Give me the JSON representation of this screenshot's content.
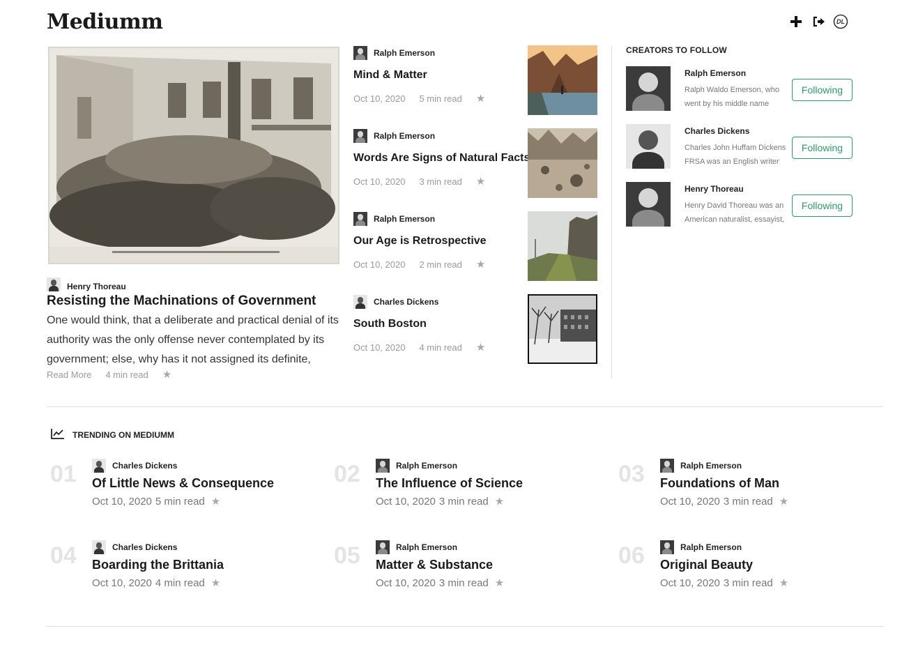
{
  "app": {
    "logo": "Mediumm"
  },
  "header": {
    "icons": [
      "plus-icon",
      "sign-out-icon",
      "user-initials-badge"
    ],
    "user_initials": "DL"
  },
  "hero": {
    "author": "Henry Thoreau",
    "title": "Resisting the Machinations of Government",
    "excerpt": "One would think, that a deliberate and practical denial of its authority was the only offense never contemplated by its government; else, why has it not assigned its definite,",
    "read_more": "Read More",
    "read_time": "4 min read"
  },
  "mid_articles": [
    {
      "author": "Ralph Emerson",
      "title": "Mind & Matter",
      "date": "Oct 10, 2020",
      "read_time": "5 min read"
    },
    {
      "author": "Ralph Emerson",
      "title": "Words Are Signs of Natural Facts",
      "date": "Oct 10, 2020",
      "read_time": "3 min read"
    },
    {
      "author": "Ralph Emerson",
      "title": "Our Age is Retrospective",
      "date": "Oct 10, 2020",
      "read_time": "2 min read"
    },
    {
      "author": "Charles Dickens",
      "title": "South Boston",
      "date": "Oct 10, 2020",
      "read_time": "4 min read"
    }
  ],
  "creators": {
    "heading": "CREATORS TO FOLLOW",
    "items": [
      {
        "name": "Ralph Emerson",
        "bio": "Ralph Waldo Emerson, who went by his middle name",
        "button": "Following"
      },
      {
        "name": "Charles Dickens",
        "bio": "Charles John Huffam Dickens FRSA was an English writer",
        "button": "Following"
      },
      {
        "name": "Henry Thoreau",
        "bio": "Henry David Thoreau was an American naturalist, essayist,",
        "button": "Following"
      }
    ]
  },
  "trending": {
    "heading": "TRENDING ON MEDIUMM",
    "items": [
      {
        "num": "01",
        "author": "Charles Dickens",
        "title": "Of Little News & Consequence",
        "date": "Oct 10, 2020",
        "read_time": "5 min read"
      },
      {
        "num": "02",
        "author": "Ralph Emerson",
        "title": "The Influence of Science",
        "date": "Oct 10, 2020",
        "read_time": "3 min read"
      },
      {
        "num": "03",
        "author": "Ralph Emerson",
        "title": "Foundations of Man",
        "date": "Oct 10, 2020",
        "read_time": "3 min read"
      },
      {
        "num": "04",
        "author": "Charles Dickens",
        "title": "Boarding the Brittania",
        "date": "Oct 10, 2020",
        "read_time": "4 min read"
      },
      {
        "num": "05",
        "author": "Ralph Emerson",
        "title": "Matter & Substance",
        "date": "Oct 10, 2020",
        "read_time": "3 min read"
      },
      {
        "num": "06",
        "author": "Ralph Emerson",
        "title": "Original Beauty",
        "date": "Oct 10, 2020",
        "read_time": "3 min read"
      }
    ]
  },
  "colors": {
    "accent": "#2f9a6c",
    "muted": "#9a9a9a",
    "rank": "#e4e4e4"
  }
}
